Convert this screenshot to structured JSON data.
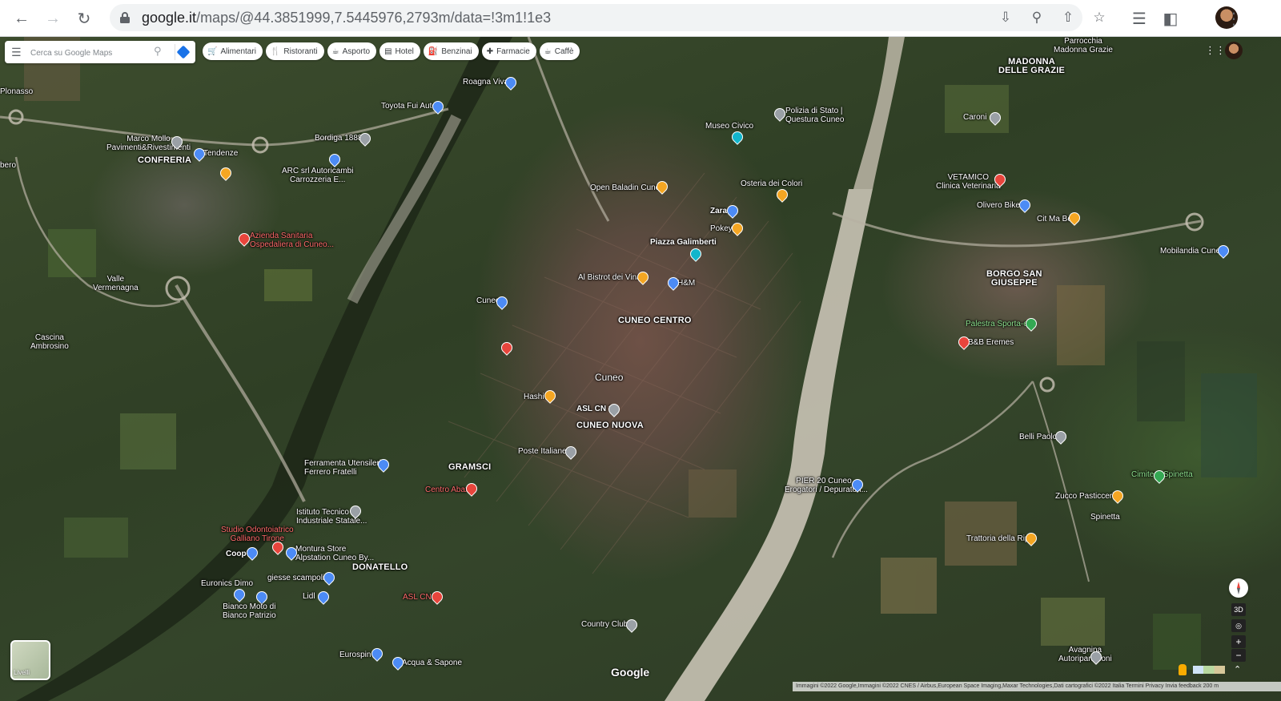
{
  "browser": {
    "url_host": "google.it",
    "url_path": "/maps/@44.3851999,7.5445976,2793m/data=!3m1!1e3"
  },
  "search": {
    "placeholder": "Cerca su Google Maps"
  },
  "chips": [
    {
      "label": "Alimentari",
      "icon": "cart-icon"
    },
    {
      "label": "Ristoranti",
      "icon": "restaurant-icon"
    },
    {
      "label": "Asporto",
      "icon": "takeout-icon"
    },
    {
      "label": "Hotel",
      "icon": "hotel-icon"
    },
    {
      "label": "Benzinai",
      "icon": "gas-station-icon"
    },
    {
      "label": "Farmacie",
      "icon": "pharmacy-icon"
    },
    {
      "label": "Caffè",
      "icon": "coffee-icon"
    }
  ],
  "map": {
    "districts": {
      "cuneo_centro": "CUNEO CENTRO",
      "cuneo_nuova": "CUNEO NUOVA",
      "gramsci": "GRAMSCI",
      "donatello": "DONATELLO",
      "borgo_san_giuseppe": "BORGO SAN\nGIUSEPPE",
      "madonna_delle_grazie": "MADONNA\nDELLE GRAZIE",
      "confreria": "CONFRERIA"
    },
    "places": {
      "roagna_vivai": "Roagna Vivai",
      "toyota_fui_auto": "Toyota Fui Auto",
      "bordiga": "Bordiga 1888",
      "arc_autoricambi": "ARC srl Autoricambi\nCarrozzeria E...",
      "marco_mollo": "Marco Mollo\nPavimenti&Rivestimenti",
      "tendenze": "Tendenze",
      "azienda_sanitaria": "Azienda Sanitaria\nOspedaliera di Cuneo...",
      "valle_vermenagna": "Valle\nVermenagna",
      "cascina_ambrosino": "Cascina\nAmbrosino",
      "plonasso": "Plonasso",
      "museo_civico": "Museo Civico",
      "polizia": "Polizia di Stato |\nQuestura Cuneo",
      "open_baladin": "Open Baladin Cuneo",
      "osteria_colori": "Osteria dei Colori",
      "zara": "Zara",
      "pokey": "Pokey",
      "piazza_galimberti": "Piazza Galimberti",
      "al_bistrot": "Al Bistrot dei Vinai",
      "hm": "H&M",
      "cuneo_station": "Cuneo",
      "cuneo_city": "Cuneo",
      "hashi": "Hashi",
      "asl_cn1": "ASL CN 1",
      "poste_italiane": "Poste Italiane",
      "ferramenta": "Ferramenta Utensileria\nFerrero Fratelli",
      "centro_abax": "Centro Abax",
      "istituto_tecnico": "Istituto Tecnico\nIndustriale Statale...",
      "studio_odonto": "Studio Odontoiatrico\nGalliano Tirone",
      "coop": "Coop",
      "montura": "Montura Store\nAlpstation Cuneo By...",
      "euronics": "Euronics Dimo",
      "giesse": "giesse scampoli",
      "lidl": "Lidl",
      "bianco_moto": "Bianco Moto di\nBianco Patrizio",
      "asl_cn1_b": "ASL CN 1",
      "country_club": "Country Club",
      "eurospin": "Eurospin",
      "acqua_sapone": "Acqua & Sapone",
      "caroni": "Caroni",
      "vetamico": "VETAMICO\nClinica Veterinaria",
      "olivero_bikes": "Olivero Bikes",
      "cit_ma_bel": "Cit Ma Bel",
      "mobilandia": "Mobilandia Cuneo",
      "palestra": "Palestra Sporta-ea",
      "bb_eremes": "B&B Eremes",
      "belli_paolo": "Belli Paolo",
      "cimitero_spinetta": "Cimitero Spinetta",
      "zucco": "Zucco Pasticceria",
      "spinetta": "Spinetta",
      "trattoria_ripa": "Trattoria della Ripa",
      "avagnina": "Avagnina\nAutoriparazioni",
      "parrocchia": "Parrocchia\nMadonna Grazie",
      "pier20": "PIER 20 Cuneo -\nErogatori / Depuratori...",
      "dbero": "bero"
    }
  },
  "controls": {
    "three_d": "3D",
    "zoom_in": "+",
    "zoom_out": "−",
    "layers_label": "Livelli"
  },
  "footer": {
    "google": "Google",
    "attribution": "Immagini ©2022 Google,Immagini ©2022 CNES / Airbus,European Space Imaging,Maxar Technologies,Dati cartografici ©2022    Italia    Termini    Privacy    Invia feedback    200 m"
  }
}
